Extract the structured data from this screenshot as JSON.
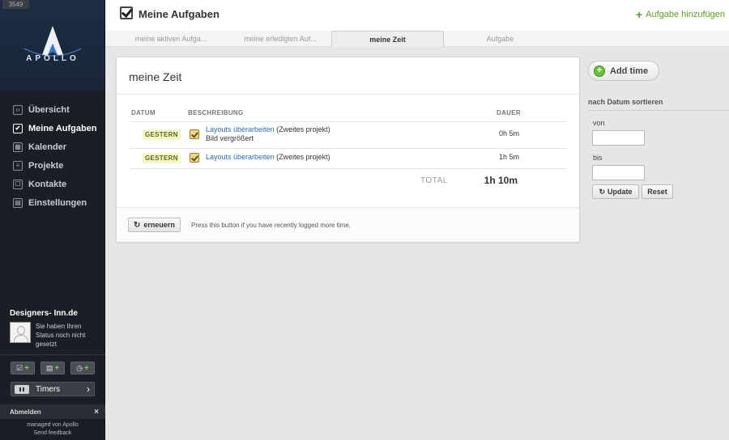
{
  "sidebar": {
    "version": "3549",
    "logo_text": "APOLLO",
    "nav": [
      {
        "label": "Übersicht",
        "icon": "overview-icon",
        "active": false
      },
      {
        "label": "Meine Aufgaben",
        "icon": "checkbox-icon",
        "active": true
      },
      {
        "label": "Kalender",
        "icon": "calendar-icon",
        "active": false
      },
      {
        "label": "Projekte",
        "icon": "projects-icon",
        "active": false
      },
      {
        "label": "Kontakte",
        "icon": "contacts-icon",
        "active": false
      },
      {
        "label": "Einstellungen",
        "icon": "settings-icon",
        "active": false
      }
    ],
    "profile": {
      "name": "Designers- Inn.de",
      "status": "Sie haben Ihren Status noch nicht gesetzt"
    },
    "timers_label": "Timers",
    "logout_label": "Abmelden",
    "managed_by": "managed von Apollo",
    "feedback": "Send feedback"
  },
  "header": {
    "title": "Meine Aufgaben",
    "add_task": "Aufgabe hinzufügen"
  },
  "tabs": [
    {
      "label": "meine aktiven Aufga...",
      "active": false
    },
    {
      "label": "meine erledigten Auf...",
      "active": false
    },
    {
      "label": "meine Zeit",
      "active": true
    },
    {
      "label": "Aufgabe",
      "active": false
    }
  ],
  "card": {
    "title": "meine Zeit",
    "columns": {
      "date": "DATUM",
      "description": "BESCHREIBUNG",
      "duration": "DAUER"
    },
    "rows": [
      {
        "date": "GESTERN",
        "task": "Layouts überarbeiten",
        "project": "(Zweites projekt)",
        "note": "Bild vergrößert",
        "duration": "0h 5m"
      },
      {
        "date": "GESTERN",
        "task": "Layouts überarbeiten",
        "project": "(Zweites projekt)",
        "note": "",
        "duration": "1h 5m"
      }
    ],
    "total_label": "TOTAL",
    "total_value": "1h 10m",
    "refresh_label": "erneuern",
    "refresh_hint": "Press this button if you have recently logged more time."
  },
  "right": {
    "add_time": "Add time",
    "sort_title": "nach Datum sortieren",
    "from_label": "von",
    "to_label": "bis",
    "update_label": "Update",
    "reset_label": "Reset"
  },
  "colors": {
    "accent_green": "#5a9e24",
    "link_blue": "#2a6db0",
    "badge_bg": "#f6f6c8",
    "sidebar_bg": "#1b1e24"
  }
}
